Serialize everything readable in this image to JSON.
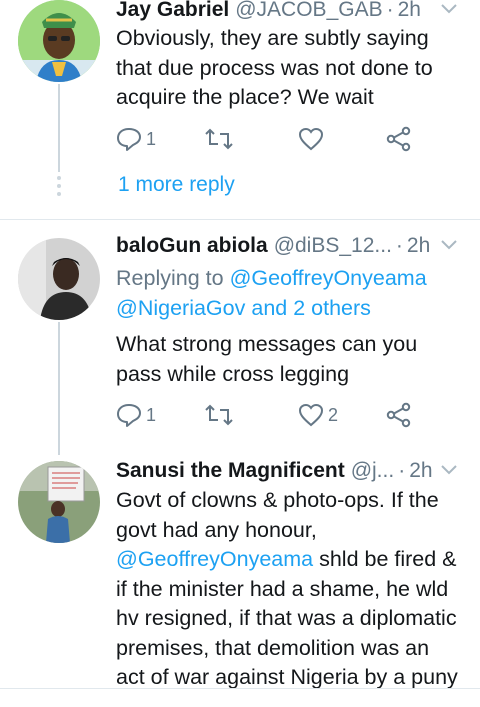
{
  "tweets": [
    {
      "name": "Jay Gabriel",
      "handle": "@JACOB_GAB",
      "time": "2h",
      "text_lines": [
        "Obviously, they are subtly saying",
        "that due process was not done to",
        "acquire the place? We wait"
      ],
      "reply_count": "1",
      "retweet_count": "",
      "like_count": "",
      "more_reply": "1 more reply"
    },
    {
      "name": "baloGun abiola",
      "handle": "@diBS_12...",
      "time": "2h",
      "replying_prefix": "Replying to",
      "replying_user": "@GeoffreyOnyeama",
      "replying_line2_user": "@NigeriaGov",
      "replying_line2_rest": "and 2 others",
      "text_lines": [
        "What strong messages can you",
        "pass while cross legging"
      ],
      "reply_count": "1",
      "retweet_count": "",
      "like_count": "2"
    },
    {
      "name": "Sanusi the Magnificent",
      "handle": "@j...",
      "time": "2h",
      "text_line1": "Govt of clowns & photo-ops. If the",
      "text_line2": "govt had any honour,",
      "mention": "@GeoffreyOnyeama",
      "text_line3_rest": " shld be fired &",
      "text_lines_rest": [
        "if the minister had a shame, he wld",
        "hv resigned, if that was a diplomatic",
        "premises, that demolition was an",
        "act of war against Nigeria by a puny"
      ]
    }
  ],
  "separator": "·",
  "colors": {
    "link": "#1da1f2",
    "secondary": "#657786",
    "line": "#ccd6dd"
  }
}
